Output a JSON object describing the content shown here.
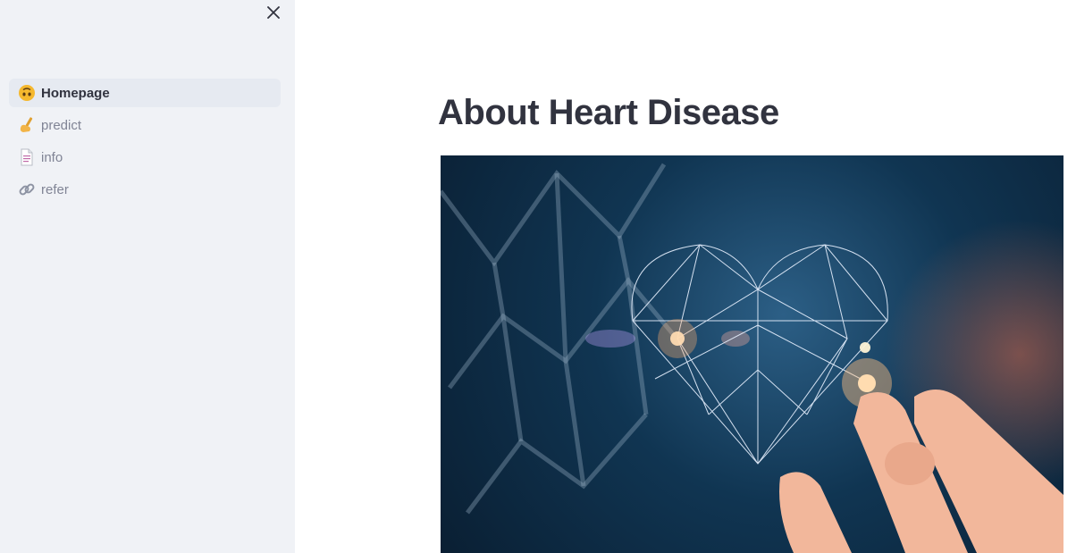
{
  "sidebar": {
    "close_icon": "close-icon",
    "items": [
      {
        "label": "Homepage",
        "icon": "upside-down-face-icon",
        "active": true
      },
      {
        "label": "predict",
        "icon": "writing-hand-icon",
        "active": false
      },
      {
        "label": "info",
        "icon": "page-facing-up-icon",
        "active": false
      },
      {
        "label": "refer",
        "icon": "link-icon",
        "active": false
      }
    ]
  },
  "main": {
    "title": "About Heart Disease",
    "hero_image": "heart-disease-banner-image"
  },
  "colors": {
    "sidebar_bg": "#f0f2f6",
    "active_item_bg": "#e6eaf1",
    "text_primary": "#31333f",
    "text_muted": "#808495"
  }
}
